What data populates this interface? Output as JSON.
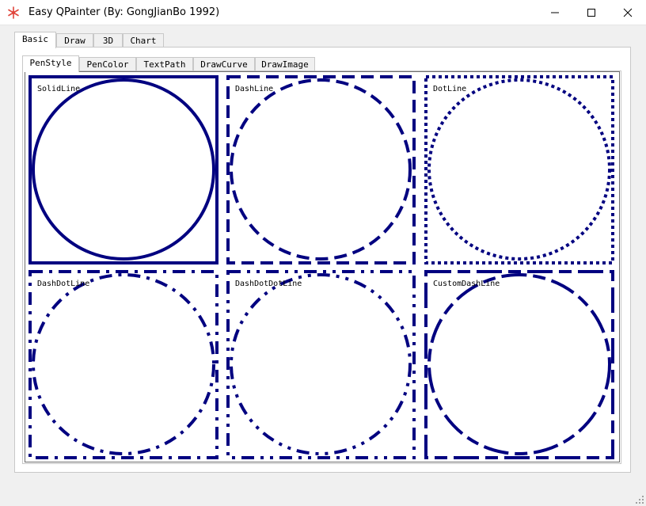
{
  "window": {
    "title": "Easy QPainter (By: GongJianBo 1992)",
    "icon": "snowflake-icon",
    "controls": [
      "minimize-icon",
      "maximize-icon",
      "close-icon"
    ]
  },
  "main_tabs": [
    {
      "label": "Basic",
      "active": true
    },
    {
      "label": "Draw",
      "active": false
    },
    {
      "label": "3D",
      "active": false
    },
    {
      "label": "Chart",
      "active": false
    }
  ],
  "sub_tabs": [
    {
      "label": "PenStyle",
      "active": true
    },
    {
      "label": "PenColor",
      "active": false
    },
    {
      "label": "TextPath",
      "active": false
    },
    {
      "label": "DrawCurve",
      "active": false
    },
    {
      "label": "DrawImage",
      "active": false
    }
  ],
  "pen_style_demo": {
    "pen_color": "#000080",
    "cells": [
      {
        "label": "SolidLine",
        "style": "solid"
      },
      {
        "label": "DashLine",
        "style": "dash"
      },
      {
        "label": "DotLine",
        "style": "dot"
      },
      {
        "label": "DashDotLine",
        "style": "dashdot"
      },
      {
        "label": "DashDotDotLine",
        "style": "dashdotdot"
      },
      {
        "label": "CustomDashLine",
        "style": "custom"
      }
    ]
  }
}
